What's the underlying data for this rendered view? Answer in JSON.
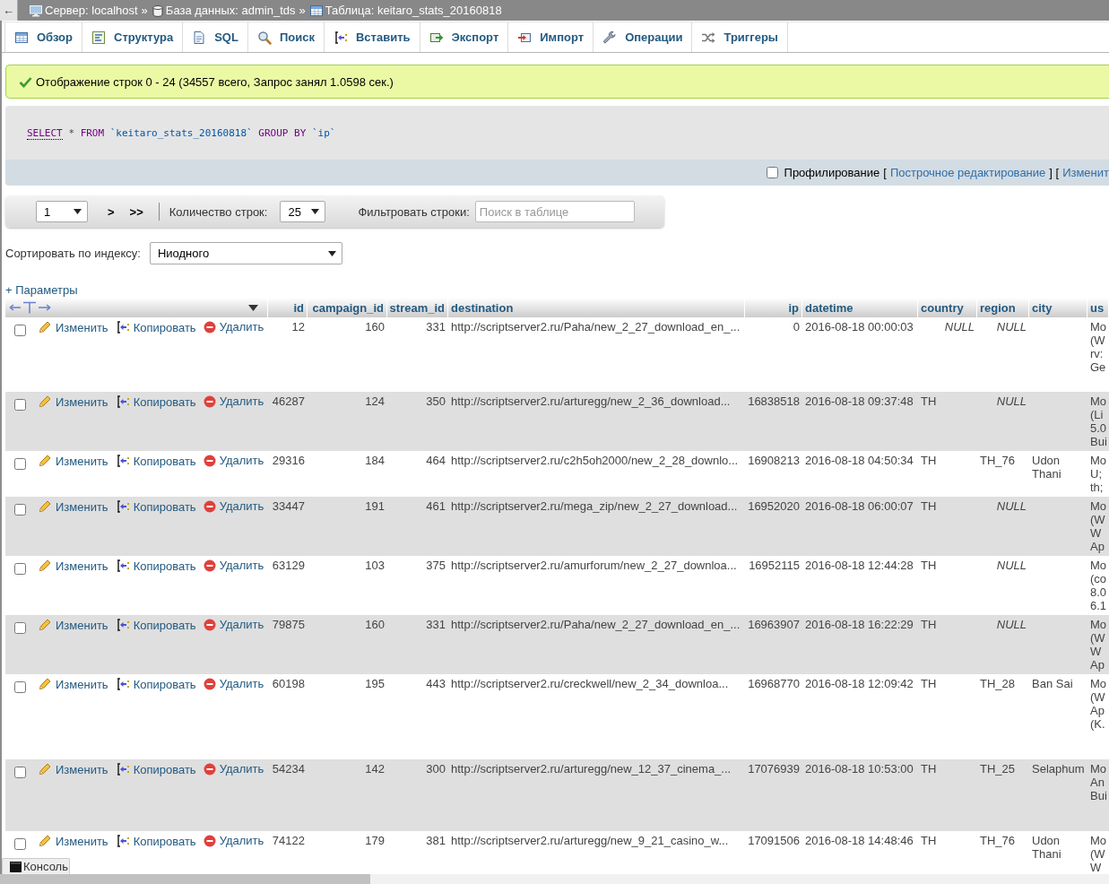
{
  "top_bar": {
    "back": "←",
    "breadcrumbs": [
      {
        "kind": "server",
        "label": "Сервер: localhost",
        "separator": "»"
      },
      {
        "kind": "database",
        "label": "База данных: admin_tds",
        "separator": "»"
      },
      {
        "kind": "table",
        "label": "Таблица: keitaro_stats_20160818"
      }
    ]
  },
  "tabs": [
    {
      "kind": "browse",
      "label": "Обзор",
      "selected": false
    },
    {
      "kind": "structure",
      "label": "Структура",
      "selected": false
    },
    {
      "kind": "sql",
      "label": "SQL",
      "selected": false
    },
    {
      "kind": "search",
      "label": "Поиск",
      "selected": false
    },
    {
      "kind": "insert",
      "label": "Вставить",
      "selected": false
    },
    {
      "kind": "export",
      "label": "Экспорт",
      "selected": false
    },
    {
      "kind": "import",
      "label": "Импорт",
      "selected": false
    },
    {
      "kind": "operations",
      "label": "Операции",
      "selected": false
    },
    {
      "kind": "triggers",
      "label": "Триггеры",
      "selected": false
    }
  ],
  "message": {
    "kind": "success",
    "text": "Отображение строк 0 - 24 (34557 всего, Запрос занял 1.0598 сек.)"
  },
  "query": {
    "tokens": [
      {
        "kind": "linked_keyword",
        "text": "SELECT"
      },
      {
        "kind": "operator",
        "text": "*"
      },
      {
        "kind": "keyword",
        "text": "FROM"
      },
      {
        "kind": "identifier",
        "text": "`keitaro_stats_20160818`"
      },
      {
        "kind": "keyword",
        "text": "GROUP BY"
      },
      {
        "kind": "identifier",
        "text": "`ip`"
      }
    ]
  },
  "query_options": {
    "profiling": {
      "label": "Профилирование",
      "checked": false
    },
    "segments": [
      {
        "kind": "bracket",
        "text": "["
      },
      {
        "kind": "link",
        "text": "Построчное редактирование"
      },
      {
        "kind": "bracket",
        "text": "] ["
      },
      {
        "kind": "link",
        "text": "Изменит"
      }
    ]
  },
  "navigation": {
    "page": "1",
    "buttons": [
      ">",
      ">>"
    ],
    "rows_label": "Количество строк:",
    "rows_value": "25",
    "filter_label": "Фильтровать строки:",
    "filter_placeholder": "Поиск в таблице"
  },
  "sort": {
    "label": "Сортировать по индексу:",
    "value": "Ниодного"
  },
  "options_link": "+ Параметры",
  "table": {
    "columns": [
      "id",
      "campaign_id",
      "stream_id",
      "destination",
      "ip",
      "datetime",
      "country",
      "region",
      "city",
      "us"
    ],
    "rows": [
      {
        "checked": false,
        "actions": [
          {
            "kind": "edit",
            "label": "Изменить"
          },
          {
            "kind": "copy",
            "label": "Копировать"
          },
          {
            "kind": "delete",
            "label": "Удалить"
          }
        ],
        "id": "12",
        "campaign_id": "160",
        "stream_id": "331",
        "destination": "http://scriptserver2.ru/Paha/new_2_27_download_en_...",
        "ip": "0",
        "datetime": "2016-08-18 00:00:03",
        "country": {
          "text": "NULL",
          "null": true
        },
        "region": {
          "text": "NULL",
          "null": true
        },
        "column_10": [
          "Mo",
          "(W",
          "rv:",
          "Ge"
        ]
      },
      {
        "checked": false,
        "actions": [
          {
            "kind": "edit",
            "label": "Изменить"
          },
          {
            "kind": "copy",
            "label": "Копировать"
          },
          {
            "kind": "delete",
            "label": "Удалить"
          }
        ],
        "id": "46287",
        "campaign_id": "124",
        "stream_id": "350",
        "destination": "http://scriptserver2.ru/arturegg/new_2_36_download...",
        "ip": "16838518",
        "datetime": "2016-08-18 09:37:48",
        "country": {
          "text": "TH",
          "null": false
        },
        "region": {
          "text": "NULL",
          "null": true
        },
        "column_10": [
          "Mo",
          "(Li",
          "5.0",
          "Bui"
        ]
      },
      {
        "checked": false,
        "actions": [
          {
            "kind": "edit",
            "label": "Изменить"
          },
          {
            "kind": "copy",
            "label": "Копировать"
          },
          {
            "kind": "delete",
            "label": "Удалить"
          }
        ],
        "id": "29316",
        "campaign_id": "184",
        "stream_id": "464",
        "destination": "http://scriptserver2.ru/c2h5oh2000/new_2_28_downlo...",
        "ip": "16908213",
        "datetime": "2016-08-18 04:50:34",
        "country": {
          "text": "TH",
          "null": false
        },
        "region": {
          "text": "TH_76",
          "null": false
        },
        "city": "Udon Thani",
        "column_10": [
          "Mo",
          "U;",
          "th;"
        ]
      },
      {
        "checked": false,
        "actions": [
          {
            "kind": "edit",
            "label": "Изменить"
          },
          {
            "kind": "copy",
            "label": "Копировать"
          },
          {
            "kind": "delete",
            "label": "Удалить"
          }
        ],
        "id": "33447",
        "campaign_id": "191",
        "stream_id": "461",
        "destination": "http://scriptserver2.ru/mega_zip/new_2_27_download...",
        "ip": "16952020",
        "datetime": "2016-08-18 06:00:07",
        "country": {
          "text": "TH",
          "null": false
        },
        "region": {
          "text": "NULL",
          "null": true
        },
        "column_10": [
          "Mo",
          "(W",
          "W",
          "Ap"
        ]
      },
      {
        "checked": false,
        "actions": [
          {
            "kind": "edit",
            "label": "Изменить"
          },
          {
            "kind": "copy",
            "label": "Копировать"
          },
          {
            "kind": "delete",
            "label": "Удалить"
          }
        ],
        "id": "63129",
        "campaign_id": "103",
        "stream_id": "375",
        "destination": "http://scriptserver2.ru/amurforum/new_2_27_downloa...",
        "ip": "16952115",
        "datetime": "2016-08-18 12:44:28",
        "country": {
          "text": "TH",
          "null": false
        },
        "region": {
          "text": "NULL",
          "null": true
        },
        "column_10": [
          "Mo",
          "(co",
          "8.0",
          "6.1"
        ]
      },
      {
        "checked": false,
        "actions": [
          {
            "kind": "edit",
            "label": "Изменить"
          },
          {
            "kind": "copy",
            "label": "Копировать"
          },
          {
            "kind": "delete",
            "label": "Удалить"
          }
        ],
        "id": "79875",
        "campaign_id": "160",
        "stream_id": "331",
        "destination": "http://scriptserver2.ru/Paha/new_2_27_download_en_...",
        "ip": "16963907",
        "datetime": "2016-08-18 16:22:29",
        "country": {
          "text": "TH",
          "null": false
        },
        "region": {
          "text": "NULL",
          "null": true
        },
        "column_10": [
          "Mo",
          "(W",
          "W",
          "Ap"
        ]
      },
      {
        "checked": false,
        "actions": [
          {
            "kind": "edit",
            "label": "Изменить"
          },
          {
            "kind": "copy",
            "label": "Копировать"
          },
          {
            "kind": "delete",
            "label": "Удалить"
          }
        ],
        "id": "60198",
        "campaign_id": "195",
        "stream_id": "443",
        "destination": "http://scriptserver2.ru/creckwell/new_2_34_downloa...",
        "ip": "16968770",
        "datetime": "2016-08-18 12:09:42",
        "country": {
          "text": "TH",
          "null": false
        },
        "region": {
          "text": "TH_28",
          "null": false
        },
        "city": "Ban Sai",
        "column_10": [
          "Mo",
          "(W",
          "Ap",
          "(K."
        ]
      },
      {
        "checked": false,
        "actions": [
          {
            "kind": "edit",
            "label": "Изменить"
          },
          {
            "kind": "copy",
            "label": "Копировать"
          },
          {
            "kind": "delete",
            "label": "Удалить"
          }
        ],
        "id": "54234",
        "campaign_id": "142",
        "stream_id": "300",
        "destination": "http://scriptserver2.ru/arturegg/new_12_37_cinema_...",
        "ip": "17076939",
        "datetime": "2016-08-18 10:53:00",
        "country": {
          "text": "TH",
          "null": false
        },
        "region": {
          "text": "TH_25",
          "null": false
        },
        "city": "Selaphum",
        "column_10": [
          "Mo",
          "An",
          "Bui"
        ]
      },
      {
        "checked": false,
        "actions": [
          {
            "kind": "edit",
            "label": "Изменить"
          },
          {
            "kind": "copy",
            "label": "Копировать"
          },
          {
            "kind": "delete",
            "label": "Удалить"
          }
        ],
        "id": "74122",
        "campaign_id": "179",
        "stream_id": "381",
        "destination": "http://scriptserver2.ru/arturegg/new_9_21_casino_w...",
        "ip": "17091506",
        "datetime": "2016-08-18 14:48:46",
        "country": {
          "text": "TH",
          "null": false
        },
        "region": {
          "text": "TH_76",
          "null": false
        },
        "city": "Udon Thani",
        "column_10": [
          "Mo",
          "(W",
          "W"
        ]
      }
    ]
  },
  "console": {
    "label": "Консоль"
  }
}
